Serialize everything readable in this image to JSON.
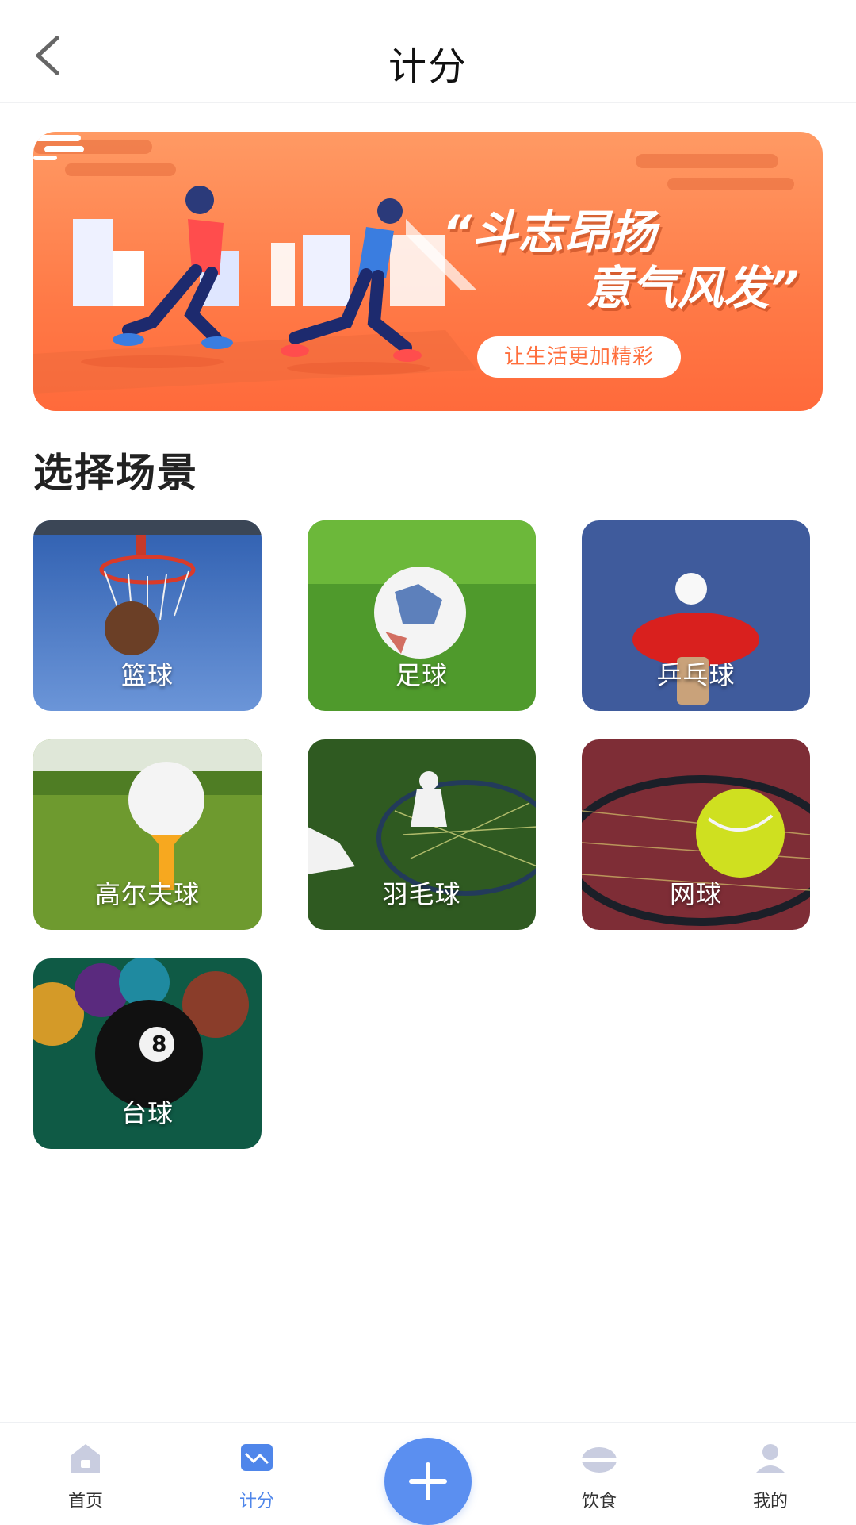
{
  "header": {
    "title": "计分",
    "back_icon": "chevron-left-icon"
  },
  "banner": {
    "slogan_line1": "“斗志昂扬",
    "slogan_line2": "意气风发”",
    "tagline": "让生活更加精彩",
    "colors": {
      "background": "#ff7a47",
      "accent": "#ffffff"
    }
  },
  "section": {
    "title": "选择场景",
    "items": [
      {
        "label": "篮球",
        "icon": "basketball"
      },
      {
        "label": "足球",
        "icon": "soccer-ball"
      },
      {
        "label": "乒乓球",
        "icon": "table-tennis"
      },
      {
        "label": "高尔夫球",
        "icon": "golf-ball"
      },
      {
        "label": "羽毛球",
        "icon": "badminton"
      },
      {
        "label": "网球",
        "icon": "tennis"
      },
      {
        "label": "台球",
        "icon": "billiards"
      }
    ]
  },
  "nav": {
    "items": [
      {
        "label": "首页",
        "icon": "home-icon"
      },
      {
        "label": "计分",
        "icon": "chart-icon",
        "active": true
      },
      {
        "label": "饮食",
        "icon": "food-icon"
      },
      {
        "label": "我的",
        "icon": "profile-icon"
      }
    ],
    "fab_icon": "plus-icon",
    "active_color": "#4f86ea"
  }
}
